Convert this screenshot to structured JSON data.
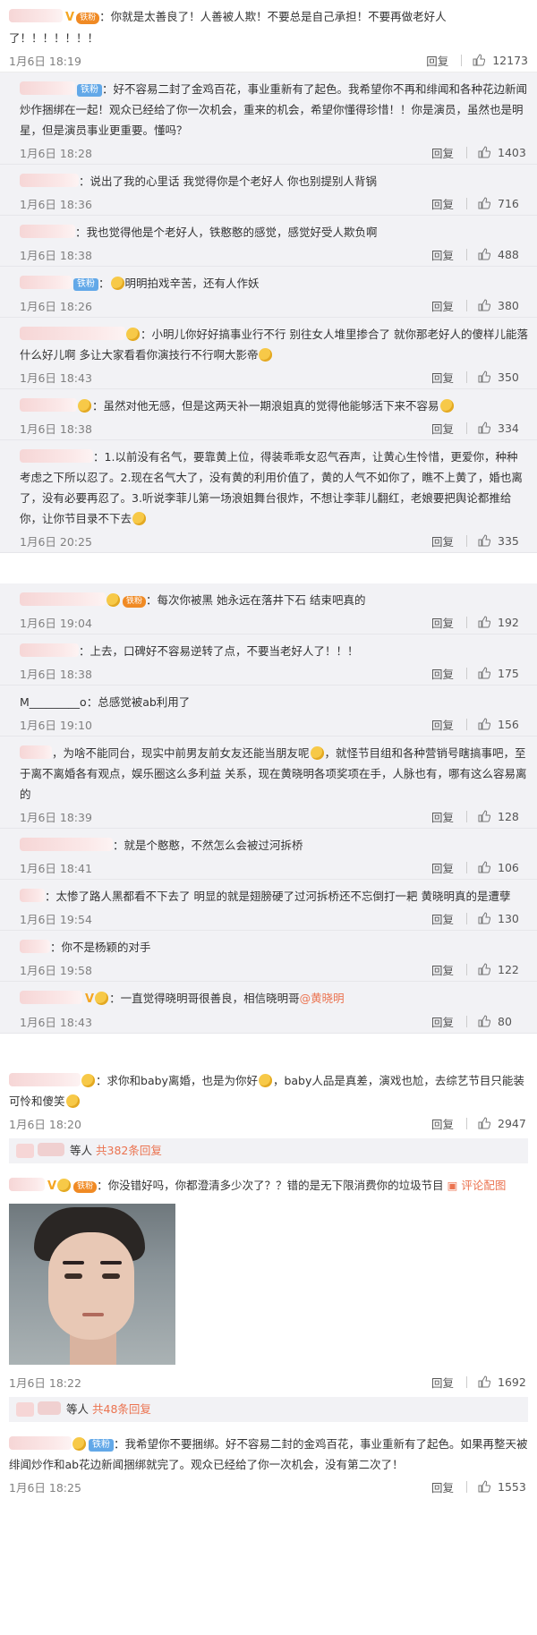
{
  "block1": {
    "top": {
      "text": "你就是太善良了！人善被人欺！不要总是自己承担！不要再做老好人了！！！！！！！",
      "time": "1月6日 18:19",
      "reply": "回复",
      "likes": "12173",
      "badge": "铁粉"
    },
    "nested": [
      {
        "badge": "铁粉",
        "text": "好不容易二封了金鸡百花，事业重新有了起色。我希望你不再和绯闻和各种花边新闻炒作捆绑在一起！观众已经给了你一次机会，重来的机会，希望你懂得珍惜！！你是演员，虽然也是明星，但是演员事业更重要。懂吗？",
        "time": "1月6日 18:28",
        "likes": "1403"
      },
      {
        "text": "说出了我的心里话 我觉得你是个老好人 你也别提别人背锅",
        "time": "1月6日 18:36",
        "likes": "716"
      },
      {
        "text": "我也觉得他是个老好人，铁憨憨的感觉，感觉好受人欺负啊",
        "time": "1月6日 18:38",
        "likes": "488"
      },
      {
        "badge": "铁粉",
        "text": "明明拍戏辛苦，还有人作妖",
        "time": "1月6日 18:26",
        "likes": "380"
      },
      {
        "text": "小明儿你好好搞事业行不行 别往女人堆里掺合了 就你那老好人的傻样儿能落什么好儿啊 多让大家看看你演技行不行啊大影帝",
        "time": "1月6日 18:43",
        "likes": "350"
      },
      {
        "text": "虽然对他无感，但是这两天补一期浪姐真的觉得他能够活下来不容易",
        "time": "1月6日 18:38",
        "likes": "334"
      },
      {
        "text": "1.以前没有名气，要靠黄上位，得装乖乖女忍气吞声，让黄心生怜惜，更爱你，种种考虑之下所以忍了。2.现在名气大了，没有黄的利用价值了，黄的人气不如你了，瞧不上黄了，婚也离了，没有必要再忍了。3.听说李菲儿第一场浪姐舞台很炸，不想让李菲儿翻红，老娘要把舆论都推给你，让你节目录不下去",
        "time": "1月6日 20:25",
        "likes": "335"
      }
    ]
  },
  "block2": {
    "top": {
      "badge": "铁粉",
      "text": "每次你被黑  她永远在落井下石  结束吧真的",
      "time": "1月6日 19:04",
      "likes": "192"
    },
    "nested": [
      {
        "text": "上去，口碑好不容易逆转了点，不要当老好人了！！！",
        "time": "1月6日 18:38",
        "likes": "175"
      },
      {
        "user": "M_________o",
        "text": "总感觉被ab利用了",
        "time": "1月6日 19:10",
        "likes": "156"
      },
      {
        "text": "为啥不能同台，现实中前男友前女友还能当朋友呢",
        "text2": "，就怪节目组和各种营销号瞎搞事吧，至于离不离婚各有观点，娱乐圈这么多利益 关系，现在黄晓明各项奖项在手，人脉也有，哪有这么容易离的",
        "time": "1月6日 18:39",
        "likes": "128"
      },
      {
        "text": "就是个憨憨，不然怎么会被过河拆桥",
        "time": "1月6日 18:41",
        "likes": "106"
      },
      {
        "text": "太惨了路人黑都看不下去了 明显的就是翅膀硬了过河拆桥还不忘倒打一耙 黄晓明真的是遭孽",
        "time": "1月6日 19:54",
        "likes": "130"
      },
      {
        "text": "你不是杨颖的对手",
        "time": "1月6日 19:58",
        "likes": "122"
      },
      {
        "text": "一直觉得晓明哥很善良，相信晓明哥",
        "mention": "@黄晓明",
        "time": "1月6日 18:43",
        "likes": "80"
      }
    ]
  },
  "block3": {
    "c1": {
      "text": "求你和baby离婚，也是为你好",
      "text2": "，baby人品是真差，演戏也尬，去综艺节目只能装可怜和傻笑",
      "time": "1月6日 18:20",
      "reply": "回复",
      "likes": "2947",
      "more_prefix": "等人",
      "more_count": "共382条回复"
    },
    "c2": {
      "badge": "铁粉",
      "text": "你没错好吗，你都澄清多少次了？？错的是无下限消费你的垃圾节目",
      "evaluate": "评论配图",
      "time": "1月6日 18:22",
      "likes": "1692",
      "more_prefix": "等人",
      "more_count": "共48条回复"
    },
    "c3": {
      "badge": "铁粉",
      "text": "我希望你不要捆绑。好不容易二封的金鸡百花，事业重新有了起色。如果再整天被绯闻炒作和ab花边新闻捆绑就完了。观众已经给了你一次机会，没有第二次了！",
      "time": "1月6日 18:25",
      "likes": "1553"
    }
  },
  "colors": {
    "accent": "#eb7350",
    "badge_gold": "#f5a623",
    "fan_badge": "#62a8e8",
    "nested_bg": "#f2f2f5"
  }
}
